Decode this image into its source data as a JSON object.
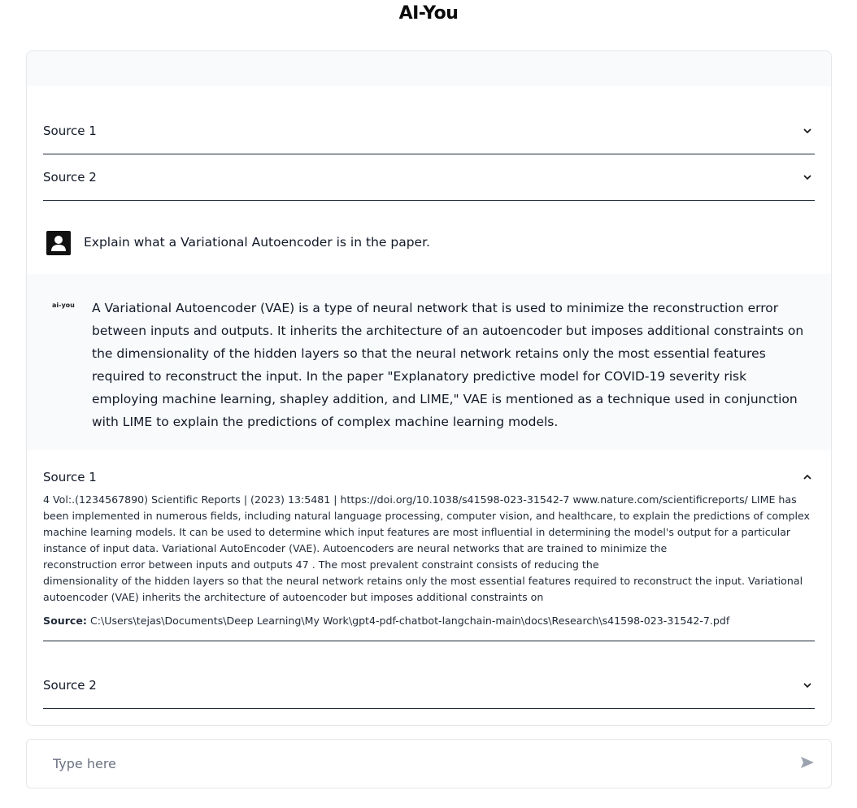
{
  "app": {
    "title": "AI-You"
  },
  "colors": {
    "border": "#e5e7eb",
    "band": "#f9fafb",
    "divider": "#1f2937",
    "icon": "#9ca3af"
  },
  "top_sources": [
    {
      "label": "Source 1",
      "expanded": false
    },
    {
      "label": "Source 2",
      "expanded": false
    }
  ],
  "user_message": {
    "avatar_icon": "user-icon",
    "text": "Explain what a Variational Autoencoder is in the paper."
  },
  "bot_message": {
    "logo_text": "ai-you",
    "text": "A Variational Autoencoder (VAE) is a type of neural network that is used to minimize the reconstruction error between inputs and outputs. It inherits the architecture of an autoencoder but imposes additional constraints on the dimensionality of the hidden layers so that the neural network retains only the most essential features required to reconstruct the input. In the paper \"Explanatory predictive model for COVID-19 severity risk employing machine learning, shapley addition, and LIME,\" VAE is mentioned as a technique used in conjunction with LIME to explain the predictions of complex machine learning models."
  },
  "bottom_sources": [
    {
      "label": "Source 1",
      "expanded": true,
      "lines": [
        "4 Vol:.(1234567890) Scientific Reports | (2023) 13:5481 | https://doi.org/10.1038/s41598-023-31542-7 www.nature.com/scientificreports/ LIME has been implemented in numerous fields, including natural language processing, computer vision, and healthcare, to explain the predictions of complex machine learning models. It can be used to determine which input features are most influential in determining the model's output for a particular instance of input data. Variational AutoEncoder (VAE). Autoencoders are neural networks that are trained to minimize the",
        "reconstruction error between inputs and outputs 47 . The most prevalent constraint consists of reducing the",
        "dimensionality of the hidden layers so that the neural network retains only the most essential features required to reconstruct the input. Variational autoencoder (VAE) inherits the architecture of autoencoder but imposes additional constraints on"
      ],
      "source_label": "Source:",
      "source_path": "C:\\Users\\tejas\\Documents\\Deep Learning\\My Work\\gpt4-pdf-chatbot-langchain-main\\docs\\Research\\s41598-023-31542-7.pdf"
    },
    {
      "label": "Source 2",
      "expanded": false
    }
  ],
  "input": {
    "placeholder": "Type here",
    "value": "",
    "send_icon": "send-icon"
  }
}
